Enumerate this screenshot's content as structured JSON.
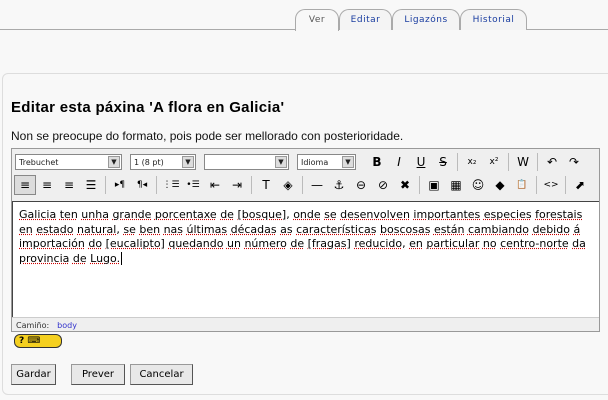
{
  "tabs": [
    {
      "label": "Ver",
      "active": true
    },
    {
      "label": "Editar"
    },
    {
      "label": "Ligazóns"
    },
    {
      "label": "Historial"
    }
  ],
  "title": "Editar esta páxina 'A flora en Galicia'",
  "hint": "Non se preocupe do formato, pois pode ser mellorado con posterioridade.",
  "toolbar": {
    "font": "Trebuchet",
    "size": "1 (8 pt)",
    "format": "",
    "language": "Idioma",
    "row1": [
      {
        "icon": "bold-icon",
        "glyph": "B"
      },
      {
        "icon": "italic-icon",
        "glyph": "I"
      },
      {
        "icon": "underline-icon",
        "glyph": "U"
      },
      {
        "icon": "strikethrough-icon",
        "glyph": "S"
      },
      {
        "sep": true
      },
      {
        "icon": "subscript-icon",
        "glyph": "x₂"
      },
      {
        "icon": "superscript-icon",
        "glyph": "x²"
      },
      {
        "sep": true
      },
      {
        "icon": "paste-word-icon",
        "glyph": "W"
      },
      {
        "sep": true
      },
      {
        "icon": "undo-icon",
        "glyph": "↶"
      },
      {
        "icon": "redo-icon",
        "glyph": "↷"
      }
    ],
    "row2": [
      {
        "icon": "align-left-icon",
        "glyph": "≡",
        "active": true
      },
      {
        "icon": "align-center-icon",
        "glyph": "≡"
      },
      {
        "icon": "align-right-icon",
        "glyph": "≡"
      },
      {
        "icon": "justify-icon",
        "glyph": "☰"
      },
      {
        "sep": true
      },
      {
        "icon": "ltr-icon",
        "glyph": "▸¶"
      },
      {
        "icon": "rtl-icon",
        "glyph": "¶◂"
      },
      {
        "sep": true
      },
      {
        "icon": "ordered-list-icon",
        "glyph": "⋮☰"
      },
      {
        "icon": "unordered-list-icon",
        "glyph": "•☰"
      },
      {
        "icon": "outdent-icon",
        "glyph": "⇤"
      },
      {
        "icon": "indent-icon",
        "glyph": "⇥"
      },
      {
        "sep": true
      },
      {
        "icon": "text-color-icon",
        "glyph": "T"
      },
      {
        "icon": "background-color-icon",
        "glyph": "◈"
      },
      {
        "sep": true
      },
      {
        "icon": "horizontal-rule-icon",
        "glyph": "—"
      },
      {
        "icon": "anchor-icon",
        "glyph": "⚓"
      },
      {
        "icon": "link-icon",
        "glyph": "⊖"
      },
      {
        "icon": "unlink-icon",
        "glyph": "⊘"
      },
      {
        "icon": "nolink-icon",
        "glyph": "✖"
      },
      {
        "sep": true
      },
      {
        "icon": "image-icon",
        "glyph": "▣"
      },
      {
        "icon": "table-icon",
        "glyph": "▦"
      },
      {
        "icon": "smiley-icon",
        "glyph": "☺"
      },
      {
        "icon": "special-char-icon",
        "glyph": "◆"
      },
      {
        "icon": "paste-icon",
        "glyph": "📋"
      },
      {
        "sep": true
      },
      {
        "icon": "html-source-icon",
        "glyph": "<>"
      },
      {
        "sep": true
      },
      {
        "icon": "fullscreen-icon",
        "glyph": "⬈"
      }
    ]
  },
  "content": "Galicia ten unha grande porcentaxe de [bosque], onde se desenvolven importantes especies forestais en estado natural, se ben nas últimas décadas as características boscosas están cambiando debido á importación do [eucalipto] quedando un número de [fragas] reducido, en particular no centro-norte da provincia de Lugo.",
  "path": {
    "label": "Camiño:",
    "value": "body"
  },
  "help_badge": "?",
  "buttons": {
    "save": "Gardar",
    "preview": "Prever",
    "cancel": "Cancelar"
  }
}
